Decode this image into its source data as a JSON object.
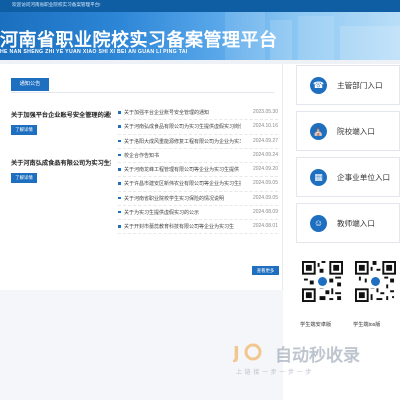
{
  "topbar": {
    "welcome": "欢迎访问河南省职业院校实习备案管理平台!"
  },
  "header": {
    "title": "河南省职业院校实习备案管理平台",
    "title_pinyin": "HE NAN SHENG ZHI YE YUAN XIAO SHI XI BEI AN GUAN LI PING TAI"
  },
  "notice": {
    "tab_label": "通知公告",
    "featured": [
      {
        "title": "关于加强平台企业账号安全管理的通知",
        "button": "了解详情"
      },
      {
        "title": "关于河南弘成食品有限公司为实习生提供虚假实习岗位的通报",
        "button": "了解详情"
      }
    ],
    "items": [
      {
        "title": "关于加强平台企业账号安全管理的通知",
        "date": "2023.05.30"
      },
      {
        "title": "关于河南弘成食品有限公司为实习生提供虚假实习岗位的通报",
        "date": "2024.10.16"
      },
      {
        "title": "关于洛阳大成风重能源修复工程有限公司为企业为实习生提供",
        "date": "2024.09.27"
      },
      {
        "title": "校企合作告知书",
        "date": "2024.09.24"
      },
      {
        "title": "关于河南龙峰工程管理有限公司等企业为实习生提供",
        "date": "2024.09.20"
      },
      {
        "title": "关于许昌市建安区新伟农业有限公司等企业为实习生提供",
        "date": "2024.09.05"
      },
      {
        "title": "关于河南省职业院校学生实习保险的情况说明",
        "date": "2024.09.05"
      },
      {
        "title": "关于为实习生提供虚假实习的公示",
        "date": "2024.08.09"
      },
      {
        "title": "关于开封市蕾蕊教育科技有限公司等企业为实习生",
        "date": "2024.08.01"
      }
    ],
    "more_button": "查看更多"
  },
  "portals": [
    {
      "label": "主管部门入口",
      "icon": "phone-icon"
    },
    {
      "label": "院校端入口",
      "icon": "school-icon"
    },
    {
      "label": "企事业单位入口",
      "icon": "building-icon"
    },
    {
      "label": "教师端入口",
      "icon": "teacher-icon"
    }
  ],
  "qr_codes": [
    {
      "caption": "学生端安卓版"
    },
    {
      "caption": "学生端ios版"
    }
  ],
  "watermark": {
    "brand": "自动秒收录",
    "tagline": "上 链 接 一 步 一 步 一 步"
  },
  "colors": {
    "primary": "#1f6fc0",
    "header_dark": "#0f5ea3"
  }
}
